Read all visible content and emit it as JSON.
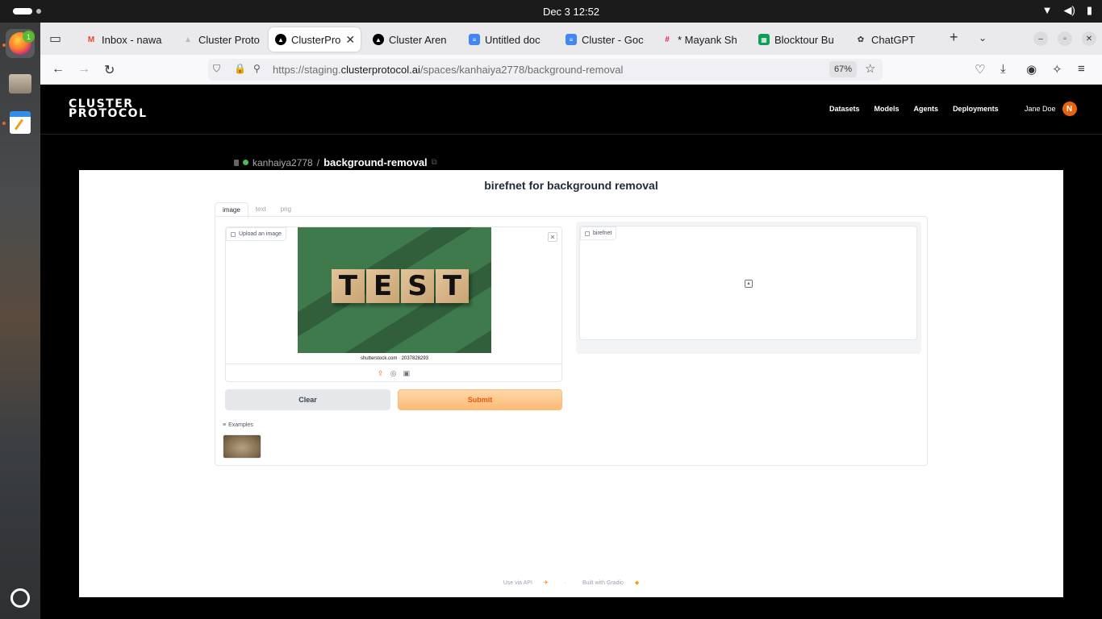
{
  "system": {
    "clock": "Dec 3  12:52",
    "dock_badge": "1"
  },
  "browser": {
    "tabs": [
      {
        "title": "Inbox - nawa",
        "icon": "gmail-icon",
        "color": "#ea4335"
      },
      {
        "title": "Cluster Proto",
        "icon": "cluster-icon",
        "color": "#cccccc"
      },
      {
        "title": "ClusterPro",
        "icon": "cluster-icon",
        "color": "#000000"
      },
      {
        "title": "Cluster Aren",
        "icon": "cluster-icon",
        "color": "#000000"
      },
      {
        "title": "Untitled doc",
        "icon": "docs-icon",
        "color": "#4285f4"
      },
      {
        "title": "Cluster - Goc",
        "icon": "docs-icon",
        "color": "#4285f4"
      },
      {
        "title": "* Mayank Sh",
        "icon": "slack-icon",
        "color": "#e01e5a"
      },
      {
        "title": "Blocktour Bu",
        "icon": "sheets-icon",
        "color": "#0f9d58"
      },
      {
        "title": "ChatGPT",
        "icon": "chatgpt-icon",
        "color": "#333333"
      }
    ],
    "url_prefix": "https://staging.",
    "url_domain": "clusterprotocol.ai",
    "url_path": "/spaces/kanhaiya2778/background-removal",
    "zoom": "67%"
  },
  "site": {
    "logo_line1": "CLUSTER",
    "logo_line2": "PROTOCOL",
    "nav": [
      "Datasets",
      "Models",
      "Agents",
      "Deployments"
    ],
    "user_name": "Jane Doe",
    "user_initial": "N"
  },
  "breadcrumb": {
    "owner": "kanhaiya2778",
    "separator": "/",
    "space": "background-removal"
  },
  "app": {
    "title": "birefnet for background removal",
    "tabs": [
      "image",
      "text",
      "png"
    ],
    "selected_tab": "image",
    "input_label": "Upload an image",
    "image_text": [
      "T",
      "E",
      "S",
      "T"
    ],
    "image_caption": "shutterstock.com · 2037828293",
    "clear_label": "Clear",
    "submit_label": "Submit",
    "output_label": "birefnet",
    "examples_label": "Examples",
    "footer_api": "Use via API",
    "footer_separator": "·",
    "footer_built": "Built with Gradio"
  },
  "colors": {
    "accent": "#f97316",
    "avatar": "#e8620f",
    "status_dot": "#4fb957"
  }
}
